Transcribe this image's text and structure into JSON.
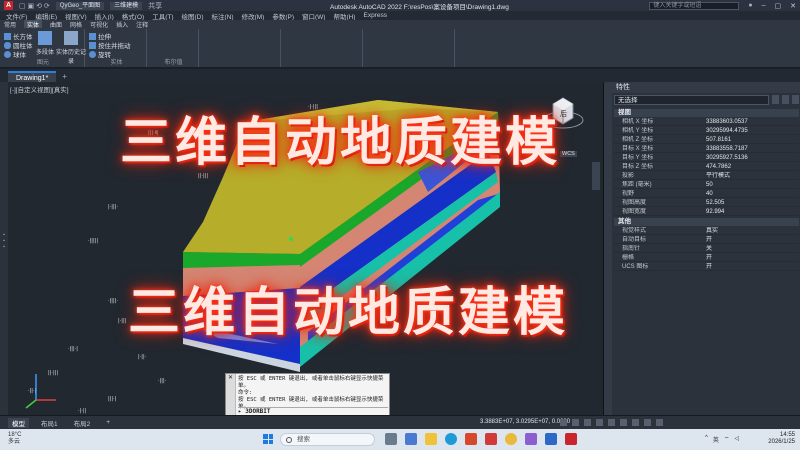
{
  "titlebar": {
    "app_icon": "A",
    "workspace_user": "QyGeo_平面图",
    "workspace": "三维建模",
    "title": "Autodesk AutoCAD 2022   F:\\resPos\\案设备项目\\Drawing1.dwg",
    "search_placeholder": "键入关键字或短语",
    "share": "共享"
  },
  "menu": {
    "items": [
      "文件(F)",
      "编辑(E)",
      "视图(V)",
      "插入(I)",
      "格式(O)",
      "工具(T)",
      "绘图(D)",
      "标注(N)",
      "修改(M)",
      "参数(P)",
      "窗口(W)",
      "帮助(H)",
      "Express"
    ]
  },
  "ribbon": {
    "tabs": [
      "常用",
      "实体",
      "曲面",
      "网格",
      "可视化",
      "插入",
      "注释"
    ],
    "group1": {
      "btn1": "长方体",
      "btn2": "圆柱体",
      "btn3": "球体",
      "big1": "多段体",
      "big2": "实体历史记录",
      "label": "图元"
    },
    "group2": {
      "btn1": "拉伸",
      "btn2": "按住并拖动",
      "btn3": "旋转",
      "label": "实体"
    },
    "group3": {
      "label": "布尔值"
    }
  },
  "doc": {
    "tab": "Drawing1*",
    "viewport_label": "[-][自定义视图][真实]"
  },
  "overlay": {
    "title_top": "三维自动地质建模",
    "title_mid": "三维自动地质建模"
  },
  "viewcube": {
    "face": "后",
    "ucs": "WCS"
  },
  "command": {
    "lines": [
      "按 ESC 或 ENTER 键退出, 或者单击鼠标右键显示快捷菜",
      "单。",
      "命令:",
      "按 ESC 或 ENTER 键退出, 或者单击鼠标右键显示快捷菜",
      "单。"
    ],
    "input": "3DORBIT"
  },
  "properties": {
    "header": "特性",
    "selection": "无选择",
    "section_view": "视图",
    "view_rows": [
      {
        "k": "相机 X 坐标",
        "v": "33883603.0537"
      },
      {
        "k": "相机 Y 坐标",
        "v": "30295994.4735"
      },
      {
        "k": "相机 Z 坐标",
        "v": "507.8161"
      },
      {
        "k": "目标 X 坐标",
        "v": "33883558.7187"
      },
      {
        "k": "目标 Y 坐标",
        "v": "30295927.5136"
      },
      {
        "k": "目标 Z 坐标",
        "v": "474.7862"
      },
      {
        "k": "投影",
        "v": "平行模式"
      },
      {
        "k": "焦距 (毫米)",
        "v": "50"
      },
      {
        "k": "视野",
        "v": "40"
      },
      {
        "k": "视图高度",
        "v": "52.505"
      },
      {
        "k": "视图宽度",
        "v": "92.994"
      }
    ],
    "section_misc": "其他",
    "misc_rows": [
      {
        "k": "视觉样式",
        "v": "真实"
      },
      {
        "k": "自动目标",
        "v": "开"
      },
      {
        "k": "指南针",
        "v": "关"
      },
      {
        "k": "栅格",
        "v": "开"
      },
      {
        "k": "UCS 图标",
        "v": "开"
      }
    ]
  },
  "layout": {
    "tabs": [
      "模型",
      "布局1",
      "布局2"
    ],
    "coords": "3.3883E+07, 3.0295E+07, 0.0000"
  },
  "taskbar": {
    "weather_temp": "18°C",
    "weather_desc": "多云",
    "search": "搜索",
    "time": "14:55",
    "date": "2026/1/25",
    "tray_lang": "英"
  },
  "colors": {
    "accent": "#2d7fd8",
    "title_glow": "#ff2b10",
    "layer_top": "#b6ae2a",
    "layer_green": "#1aa82a",
    "layer_salmon": "#d48673",
    "layer_blue": "#1430c8",
    "layer_teal": "#17c0a8"
  }
}
